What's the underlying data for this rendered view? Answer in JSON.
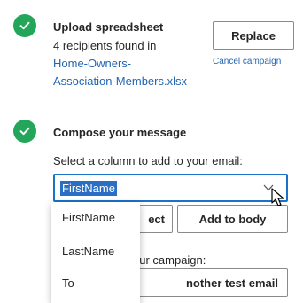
{
  "upload": {
    "title": "Upload spreadsheet",
    "recipients_text": "4 recipients found in",
    "file_line1": "Home-Owners-",
    "file_line2": "Association-Members.xlsx",
    "replace_label": "Replace",
    "cancel_label": "Cancel campaign",
    "check_icon": "check-icon",
    "check_color": "#23a55a"
  },
  "compose": {
    "title": "Compose your message",
    "column_prompt": "Select a column to add to your email:",
    "column_select": {
      "selected": "FirstName",
      "options": [
        "FirstName",
        "LastName",
        "To"
      ]
    },
    "select_button_partial": "ect",
    "add_to_body_label": "Add to body",
    "subject_label_partial": "our campaign:",
    "subject_value_partial": "nother test email",
    "check_icon": "check-icon",
    "check_color": "#23a55a"
  },
  "theme": {
    "accent": "#1a73c8",
    "link": "#2466b0",
    "highlight": "#2b6fc4"
  }
}
